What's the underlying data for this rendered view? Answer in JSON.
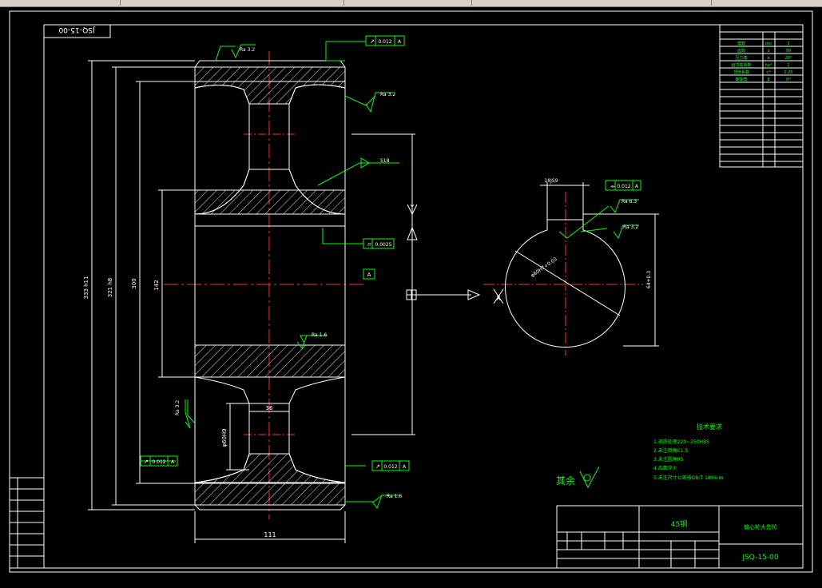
{
  "app": {
    "toolbar_strip": "cad-toolbar-strip"
  },
  "drawing": {
    "stamp": "JSQ-15-00",
    "material": "45钢",
    "title_block_name": "偏心轮大齿轮",
    "title_block_number": "JSQ-15-00",
    "roughness_other": "其余",
    "tech_req_title": "技术要求",
    "tech_req": [
      "1.调质处理220~250HBS",
      "2.未注倒角C1.5",
      "3.未注圆角R5",
      "4.齿面淬火",
      "5.未注尺寸公差按GB/T 1804-m"
    ],
    "param_rows": [
      [
        "模数",
        "mn",
        "3"
      ],
      [
        "齿数",
        "z",
        "99"
      ],
      [
        "压力角",
        "α",
        "20°"
      ],
      [
        "齿顶高系数",
        "ha*",
        "1"
      ],
      [
        "顶隙系数",
        "c*",
        "0.25"
      ],
      [
        "螺旋角",
        "β",
        "0°"
      ]
    ],
    "dims": {
      "d_outer": "333 h11",
      "d_root": "321 h8",
      "d_hub": "300",
      "d_web": "142",
      "width": "111",
      "hub_width": "36",
      "bore": "φ60H9",
      "key_width": "18JS9",
      "key_depth": "64+0.3",
      "bore_dim": "φ60H7+0.03"
    },
    "roughness": [
      "Ra 3.2",
      "Ra 3.2",
      "Ra 1.6",
      "Ra 3.2",
      "Ra 1.6",
      "Ra 6.3",
      "Ra 3.2"
    ],
    "tolerance": {
      "runout_top": "0.012",
      "runout_left": "0.012",
      "runout_right": "0.012",
      "cylindricity": "0.0025",
      "symmetry": "0.012",
      "datum": "A",
      "chamfer_note": "S18"
    },
    "view_labels": {
      "section": "Y",
      "direction": "X"
    }
  }
}
